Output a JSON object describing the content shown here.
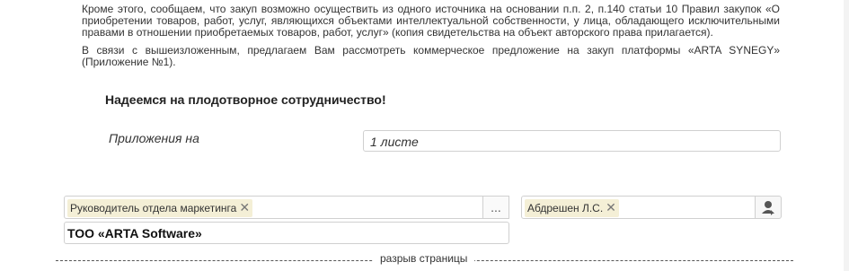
{
  "document": {
    "paragraph1": "Кроме этого, сообщаем, что закуп возможно осуществить из одного источника на основании п.п. 2, п.140 статьи 10 Правил закупок «О приобретении товаров, работ, услуг, являющихся объектами интеллектуальной собственности, у лица, обладающего исключительными правами в отношении приобретаемых товаров, работ, услуг» (копия свидетельства на объект авторского права прилагается).",
    "paragraph2": "В связи с вышеизложенным, предлагаем Вам рассмотреть коммерческое предложение на закуп платформы «ARTA SYNEGY» (Приложение №1).",
    "closing": "Надеемся на плодотворное сотрудничество!"
  },
  "attachments": {
    "label": "Приложения на",
    "value": "1 листе"
  },
  "signatory": {
    "position_tag": "Руководитель отдела маркетинга",
    "position_more": "...",
    "name_tag": "Абдрешен Л.С.",
    "organization": "ТОО «ARTA Software»",
    "remove_glyph": "✕"
  },
  "page_break": {
    "label": "разрыв страницы"
  }
}
